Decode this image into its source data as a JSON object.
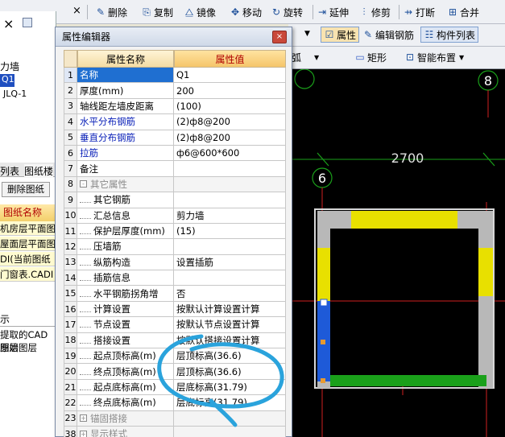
{
  "toolbar": {
    "close_glyph": "×",
    "items": [
      {
        "icon": "✎",
        "label": "删除"
      },
      {
        "icon": "⎘",
        "label": "复制"
      },
      {
        "icon": "⧋",
        "label": "镜像"
      },
      {
        "icon": "✥",
        "label": "移动"
      },
      {
        "icon": "↻",
        "label": "旋转"
      },
      {
        "icon": "⇥",
        "label": "延伸"
      },
      {
        "icon": "⫶",
        "label": "修剪"
      },
      {
        "icon": "⇸",
        "label": "打断"
      },
      {
        "icon": "⊞",
        "label": "合并"
      }
    ],
    "row2": [
      {
        "icon": "☑",
        "label": "属性"
      },
      {
        "icon": "✎",
        "label": "编辑钢筋"
      },
      {
        "icon": "☷",
        "label": "构件列表"
      }
    ],
    "row3": [
      {
        "label": "弧"
      },
      {
        "icon": "▭",
        "label": "矩形"
      },
      {
        "icon": "⊡",
        "label": "智能布置"
      }
    ]
  },
  "left_panel": {
    "tree_items": [
      "力墙",
      "Q1",
      "JLQ-1"
    ],
    "tabs": [
      "列表",
      "图纸楼"
    ],
    "delete_button": "删除图纸",
    "header": "图纸名称",
    "files": [
      "机房层平面图",
      "屋面层平面图",
      "DI(当前图纸",
      "门窗表.CADI"
    ],
    "bottom_lines": [
      "示",
      "提取的CAD图层",
      "原始图层"
    ]
  },
  "dialog": {
    "title": "属性编辑器",
    "close": "×",
    "col_name": "属性名称",
    "col_value": "属性值",
    "rows": [
      {
        "n": "1",
        "name": "名称",
        "value": "Q1",
        "blue": true,
        "sel": true
      },
      {
        "n": "2",
        "name": "厚度(mm)",
        "value": "200"
      },
      {
        "n": "3",
        "name": "轴线距左墙皮距离",
        "value": "(100)"
      },
      {
        "n": "4",
        "name": "水平分布钢筋",
        "value": "(2)ф8@200",
        "blue": true
      },
      {
        "n": "5",
        "name": "垂直分布钢筋",
        "value": "(2)ф8@200",
        "blue": true
      },
      {
        "n": "6",
        "name": "拉筋",
        "value": "ф6@600*600",
        "blue": true
      },
      {
        "n": "7",
        "name": "备注",
        "value": ""
      },
      {
        "n": "8",
        "name": "其它属性",
        "value": "",
        "group": "-",
        "grey": true
      },
      {
        "n": "9",
        "name": "其它钢筋",
        "value": "",
        "child": true
      },
      {
        "n": "10",
        "name": "汇总信息",
        "value": "剪力墙",
        "child": true
      },
      {
        "n": "11",
        "name": "保护层厚度(mm)",
        "value": "(15)",
        "child": true
      },
      {
        "n": "12",
        "name": "压墙筋",
        "value": "",
        "child": true
      },
      {
        "n": "13",
        "name": "纵筋构造",
        "value": "设置插筋",
        "child": true
      },
      {
        "n": "14",
        "name": "插筋信息",
        "value": "",
        "child": true
      },
      {
        "n": "15",
        "name": "水平钢筋拐角增",
        "value": "否",
        "child": true
      },
      {
        "n": "16",
        "name": "计算设置",
        "value": "按默认计算设置计算",
        "child": true
      },
      {
        "n": "17",
        "name": "节点设置",
        "value": "按默认节点设置计算",
        "child": true
      },
      {
        "n": "18",
        "name": "搭接设置",
        "value": "按默认搭接设置计算",
        "child": true
      },
      {
        "n": "19",
        "name": "起点顶标高(m)",
        "value": "层顶标高(36.6)",
        "child": true
      },
      {
        "n": "20",
        "name": "终点顶标高(m)",
        "value": "层顶标高(36.6)",
        "child": true
      },
      {
        "n": "21",
        "name": "起点底标高(m)",
        "value": "层底标高(31.79)",
        "child": true
      },
      {
        "n": "22",
        "name": "终点底标高(m)",
        "value": "层底标高(31.79)",
        "child": true
      },
      {
        "n": "23",
        "name": "锚固搭接",
        "value": "",
        "group": "+",
        "grey": true
      },
      {
        "n": "38",
        "name": "显示样式",
        "value": "",
        "group": "+",
        "grey": true
      }
    ]
  },
  "canvas": {
    "axis_labels": [
      "8",
      "6"
    ],
    "dimension": "2700",
    "colors": {
      "wall_yellow": "#e8e000",
      "wall_blue": "#1e5ad8",
      "wall_green": "#1aa01a",
      "wall_grey": "#b8b8b8",
      "axis_red": "#d02020"
    }
  }
}
